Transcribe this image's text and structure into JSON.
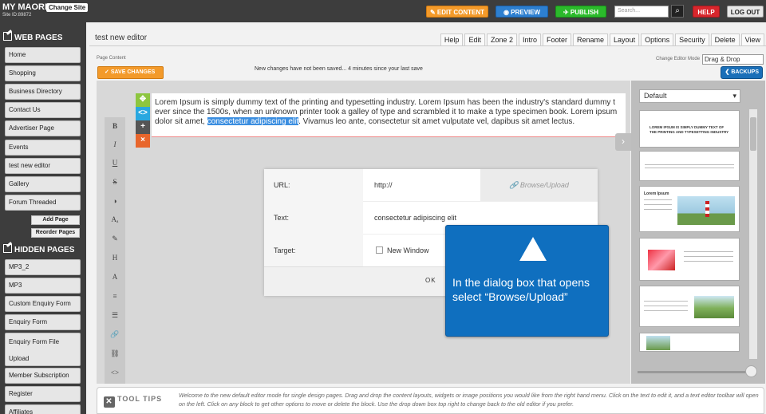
{
  "topbar": {
    "brand": "MY MAORI",
    "site_id": "Site ID:89872",
    "change_site": "Change Site",
    "edit_content": "EDIT CONTENT",
    "preview": "PREVIEW",
    "publish": "PUBLISH",
    "search_placeholder": "Search...",
    "help": "HELP",
    "logout": "LOG OUT"
  },
  "sidebar": {
    "web_pages_heading": "WEB PAGES",
    "web_pages": [
      "Home",
      "Shopping",
      "Business Directory",
      "Contact Us",
      "Advertiser Page",
      "Events",
      "test new editor",
      "Gallery",
      "Forum Threaded"
    ],
    "add_page": "Add Page",
    "reorder_pages": "Reorder Pages",
    "hidden_pages_heading": "HIDDEN PAGES",
    "hidden_pages": [
      "MP3_2",
      "MP3",
      "Custom Enquiry Form",
      "Enquiry Form",
      "Enquiry Form File",
      "Upload",
      "Member Subscription",
      "Register",
      "Affiliates"
    ]
  },
  "header": {
    "page_title": "test new editor",
    "tabs": [
      "Help",
      "Edit",
      "Zone 2",
      "Intro",
      "Footer",
      "Rename",
      "Layout",
      "Options",
      "Security",
      "Delete",
      "View"
    ],
    "page_content_label": "Page Content",
    "mode_label": "Change Editor Mode",
    "mode_value": "Drag & Drop"
  },
  "editor": {
    "save_changes": "SAVE CHANGES",
    "unsaved_msg": "New changes have not been saved... 4 minutes since your last save",
    "backups": "BACKUPS",
    "text_line1": "Lorem Ipsum is simply dummy text of the printing and typesetting industry. Lorem Ipsum has been the industry's standard dummy t",
    "text_line2": "ever since the 1500s, when an unknown printer took a galley of type and scrambled it to make a type specimen book. Lorem ipsum",
    "text_line3_pre": "dolor sit amet, ",
    "text_line3_sel": "consectetur adipiscing elit",
    "text_line3_post": ". Vivamus leo ante, consectetur sit amet vulputate vel, dapibus sit amet lectus.",
    "block_tools": [
      "✥",
      "<>",
      "+",
      "×"
    ],
    "toolbar_buttons": [
      "B",
      "I",
      "U",
      "S",
      "◑",
      "Aₐ",
      "✎",
      "H",
      "A",
      "≡",
      "☰",
      "🔗",
      "⛓",
      "<>"
    ]
  },
  "dialog": {
    "url_label": "URL:",
    "url_value": "http://",
    "browse_upload": "Browse/Upload",
    "text_label": "Text:",
    "text_value": "consectetur adipiscing elit",
    "target_label": "Target:",
    "new_window": "New Window",
    "ok": "OK"
  },
  "callout": {
    "text": "In the dialog box that opens select “Browse/Upload”"
  },
  "right_panel": {
    "layout_select": "Default",
    "thumb1_title": "LOREM IPSUM IS SIMPLY DUMMY TEXT OF THE PRINTING AND TYPESETTING INDUSTRY",
    "thumb3_title": "Lorem Ipsum"
  },
  "tooltips": {
    "logo": "TOOL TIPS",
    "text": "Welcome to the new default editor mode for single design pages. Drag and drop the content layouts, widgets or image positions you would like from the right hand menu. Click on the text to edit it, and a text editor toolbar will open on the left. Click on any block to get other options to move or delete the block. Use the drop down box top right to change back to the old editor if you prefer."
  },
  "colors": {
    "accent_orange": "#f39a2a",
    "preview_blue": "#2d7fd0",
    "publish_green": "#2bba2b",
    "help_red": "#d8262c",
    "callout_blue": "#0f6fbf"
  }
}
